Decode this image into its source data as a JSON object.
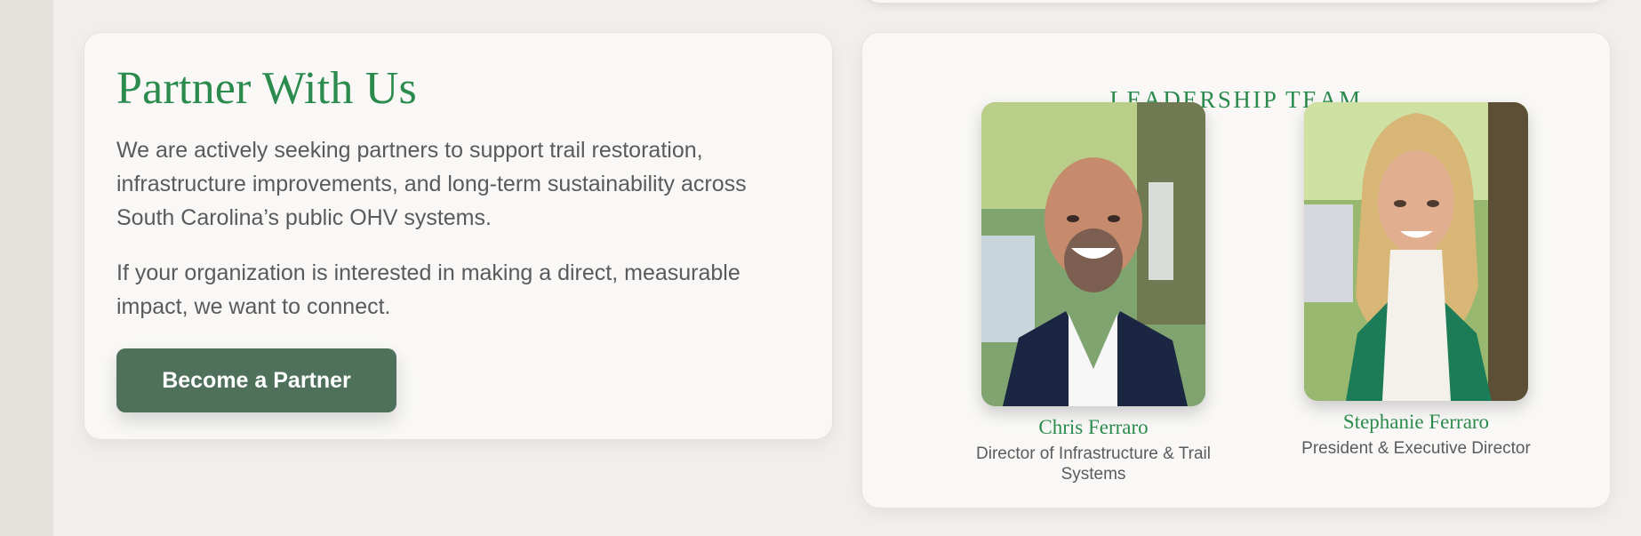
{
  "partner": {
    "title": "Partner With Us",
    "paragraphs": [
      "We are actively seeking partners to support trail restoration, infrastructure improvements, and long-term sustainability across South Carolina’s public OHV systems.",
      "If your organization is interested in making a direct, measurable impact, we want to connect."
    ],
    "button_label": "Become a Partner"
  },
  "leadership": {
    "heading": "LEADERSHIP TEAM",
    "members": [
      {
        "name": "Chris Ferraro",
        "title": "Director of Infrastructure & Trail Systems",
        "photo_alt": "Chris Ferraro"
      },
      {
        "name": "Stephanie Ferraro",
        "title": "President & Executive Director",
        "photo_alt": "Stephanie Ferraro"
      }
    ]
  },
  "colors": {
    "accent_green": "#2a8b4d",
    "button_green": "#4f715c",
    "page_bg": "#f1efeb",
    "card_bg": "#f9f8f6",
    "text_gray": "#5a5a5a"
  }
}
